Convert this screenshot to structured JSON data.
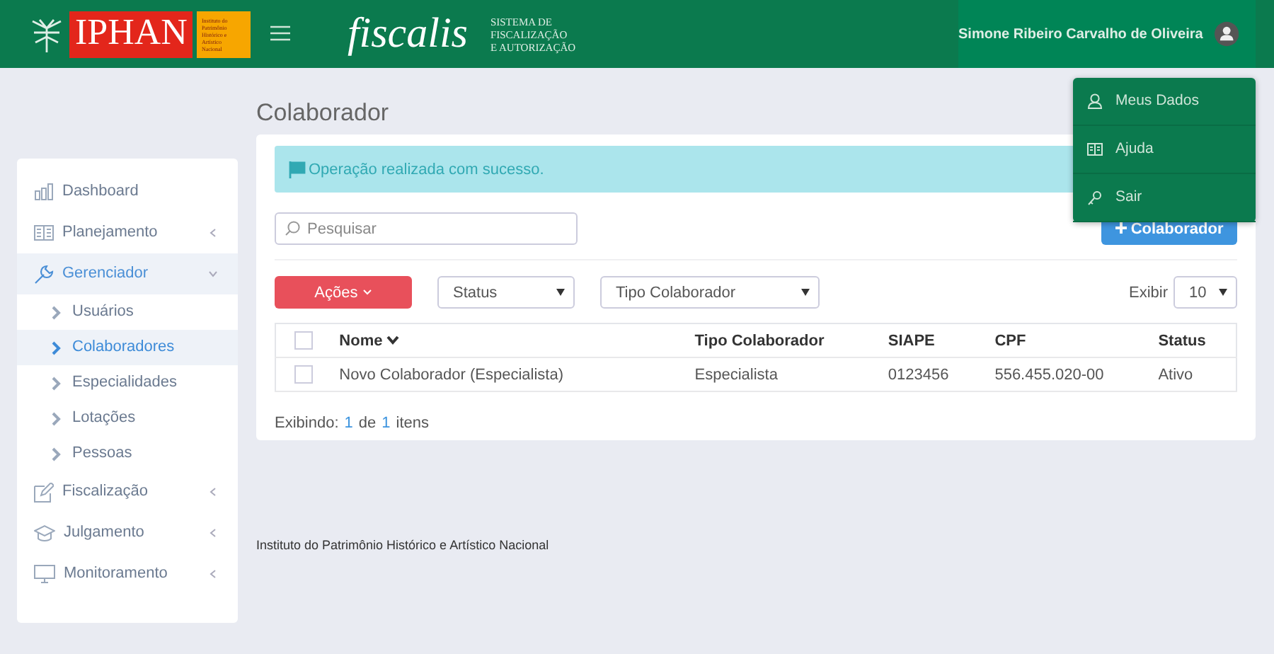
{
  "header": {
    "logo_text": "IPHAN",
    "logo_tag": [
      "Instituto do",
      "Patrimônio",
      "Histórico e",
      "Artístico",
      "Nacional"
    ],
    "app_name": "fiscalis",
    "app_subtitle": [
      "SISTEMA DE",
      "FISCALIZAÇÃO",
      "E AUTORIZAÇÃO"
    ],
    "user_name": "Simone Ribeiro Carvalho de Oliveira"
  },
  "user_menu": {
    "open": true,
    "items": [
      "Meus Dados",
      "Ajuda",
      "Sair"
    ]
  },
  "sidebar": {
    "items": [
      {
        "label": "Dashboard",
        "kind": "link",
        "selected": false
      },
      {
        "label": "Planejamento",
        "kind": "group",
        "expanded": false,
        "selected": false
      },
      {
        "label": "Gerenciador",
        "kind": "group",
        "expanded": true,
        "selected": true,
        "children": [
          {
            "label": "Usuários",
            "selected": false
          },
          {
            "label": "Colaboradores",
            "selected": true
          },
          {
            "label": "Especialidades",
            "selected": false
          },
          {
            "label": "Lotações",
            "selected": false
          },
          {
            "label": "Pessoas",
            "selected": false
          }
        ]
      },
      {
        "label": "Fiscalização",
        "kind": "group",
        "expanded": false,
        "selected": false
      },
      {
        "label": "Julgamento",
        "kind": "group",
        "expanded": false,
        "selected": false
      },
      {
        "label": "Monitoramento",
        "kind": "group",
        "expanded": false,
        "selected": false
      }
    ]
  },
  "page_title": "Colaborador",
  "alert": "Operação realizada com sucesso.",
  "search": {
    "placeholder": "Pesquisar"
  },
  "add_button": "Colaborador",
  "actions_button": "Ações",
  "filters": [
    {
      "value": "Status"
    },
    {
      "value": "Tipo Colaborador"
    }
  ],
  "page_size": {
    "label": "Exibir",
    "value": "10"
  },
  "table": {
    "columns": [
      {
        "label": "Nome",
        "sorted": true
      },
      {
        "label": "Tipo Colaborador",
        "sorted": false
      },
      {
        "label": "SIAPE",
        "sorted": false
      },
      {
        "label": "CPF",
        "sorted": false
      },
      {
        "label": "Status",
        "sorted": false
      }
    ],
    "header_checked": false,
    "rows": [
      {
        "checked": false,
        "cells": [
          "Novo Colaborador (Especialista)",
          "Especialista",
          "0123456",
          "556.455.020-00",
          "Ativo"
        ]
      }
    ]
  },
  "pagination_info": [
    {
      "text": "Exibindo:",
      "link": false
    },
    {
      "text": "1",
      "link": true
    },
    {
      "text": "de",
      "link": false
    },
    {
      "text": "1",
      "link": true
    },
    {
      "text": "itens",
      "link": false
    }
  ],
  "footer": "Instituto do Patrimônio Histórico e Artístico Nacional"
}
